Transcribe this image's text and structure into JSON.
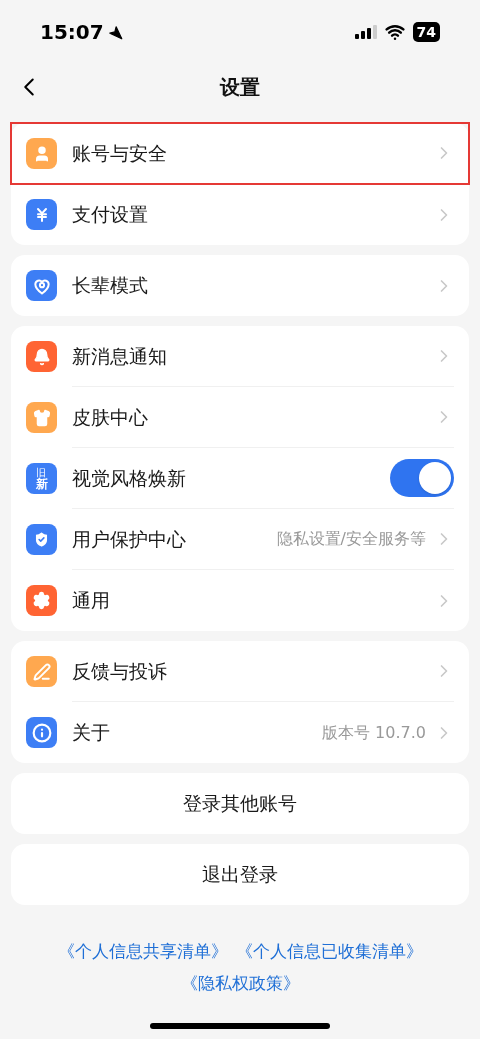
{
  "status_bar": {
    "time": "15:07",
    "battery": "74"
  },
  "nav": {
    "title": "设置"
  },
  "groups": [
    {
      "items": [
        {
          "kind": "link",
          "label": "账号与安全",
          "highlighted": true
        },
        {
          "kind": "link",
          "label": "支付设置",
          "highlighted": false
        }
      ]
    },
    {
      "items": [
        {
          "kind": "link",
          "label": "长辈模式",
          "highlighted": false
        }
      ]
    },
    {
      "items": [
        {
          "kind": "link",
          "label": "新消息通知",
          "highlighted": false
        },
        {
          "kind": "link",
          "label": "皮肤中心",
          "highlighted": false
        },
        {
          "kind": "toggle",
          "icon_labels": [
            "旧",
            "新"
          ],
          "label": "视觉风格焕新",
          "on": true,
          "highlighted": false
        },
        {
          "kind": "link",
          "label": "用户保护中心",
          "detail": "隐私设置/安全服务等",
          "highlighted": false
        },
        {
          "kind": "link",
          "label": "通用",
          "highlighted": false
        }
      ]
    },
    {
      "items": [
        {
          "kind": "link",
          "label": "反馈与投诉",
          "highlighted": false
        },
        {
          "kind": "link",
          "label": "关于",
          "detail": "版本号 10.7.0",
          "highlighted": false
        }
      ]
    }
  ],
  "buttons": [
    "登录其他账号",
    "退出登录"
  ],
  "links": [
    [
      "《个人信息共享清单》",
      "《个人信息已收集清单》"
    ],
    [
      "《隐私权政策》"
    ]
  ]
}
